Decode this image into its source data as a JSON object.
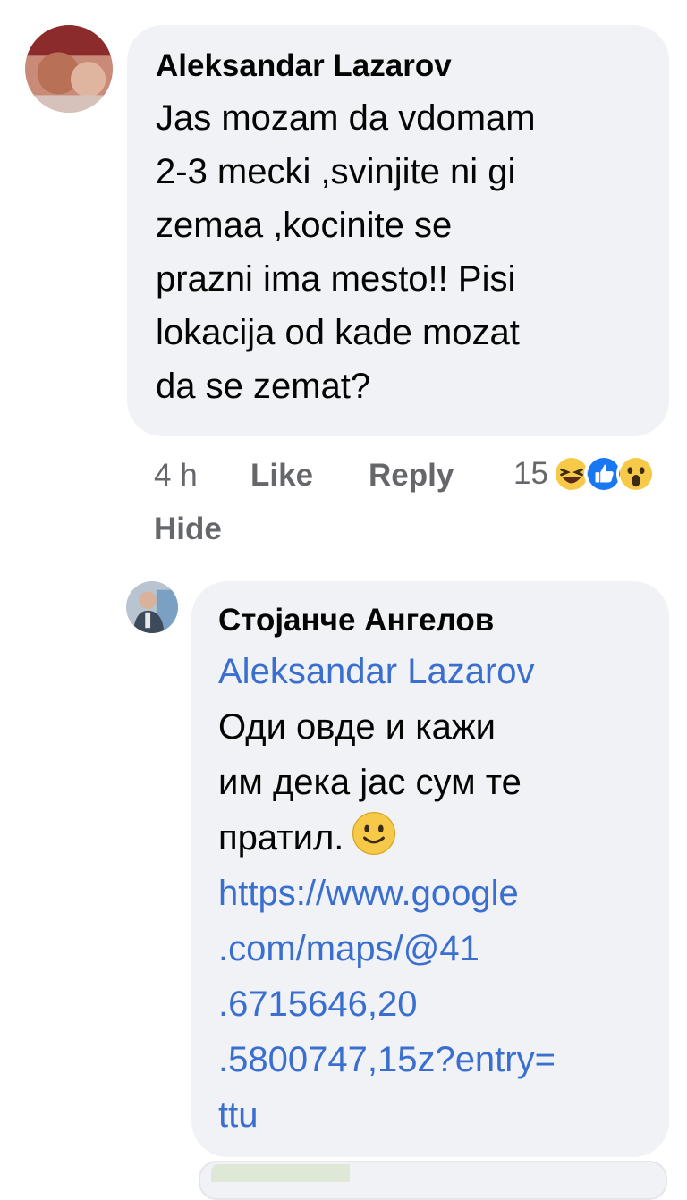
{
  "comment": {
    "author": "Aleksandar Lazarov",
    "text_lines": [
      "Jas mozam da vdomam",
      "2-3 mecki ,svinjite ni gi",
      "zemaa ,kocinite se",
      "prazni ima mesto!! Pisi",
      "lokacija od kade mozat",
      "da se zemat?"
    ],
    "time": "4 h",
    "like_label": "Like",
    "reply_label": "Reply",
    "hide_label": "Hide",
    "reaction_count": "15",
    "reaction_icons": [
      "haha-icon",
      "like-icon",
      "wow-icon"
    ]
  },
  "reply": {
    "author": "Стојанче Ангелов",
    "mention": "Aleksandar Lazarov",
    "text_lines": [
      "Оди овде и кажи",
      "им дека јас сум те",
      "пратил."
    ],
    "emoji": "slightly-smiling-face-icon",
    "link_lines": [
      "https://www.google",
      ".com/maps/@41",
      ".6715646,20",
      ".5800747,15z?entry=",
      "ttu"
    ]
  },
  "colors": {
    "bubble": "#f0f2f5",
    "link": "#3a6fd0",
    "meta": "#65676b",
    "text": "#050505"
  }
}
